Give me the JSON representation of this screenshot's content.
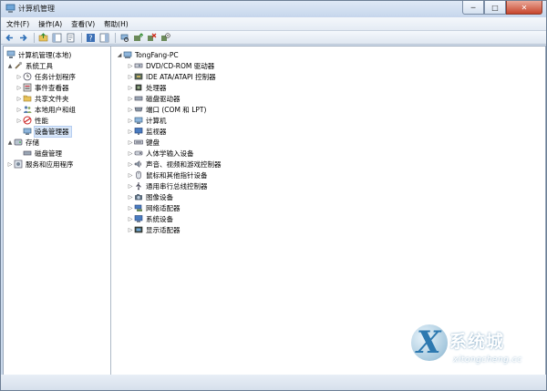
{
  "window": {
    "title": "计算机管理",
    "controls": [
      "─",
      "□",
      "✕"
    ]
  },
  "menu": [
    "文件(F)",
    "操作(A)",
    "查看(V)",
    "帮助(H)"
  ],
  "left_tree": [
    {
      "label": "计算机管理(本地)",
      "icon": "computer-mgmt-icon",
      "arrow": ""
    },
    {
      "label": "系统工具",
      "icon": "tools-icon",
      "arrow": "▲"
    },
    {
      "label": "任务计划程序",
      "icon": "clock-icon",
      "arrow": "▷"
    },
    {
      "label": "事件查看器",
      "icon": "event-viewer-icon",
      "arrow": "▷"
    },
    {
      "label": "共享文件夹",
      "icon": "shared-folder-icon",
      "arrow": "▷"
    },
    {
      "label": "本地用户和组",
      "icon": "users-icon",
      "arrow": "▷"
    },
    {
      "label": "性能",
      "icon": "performance-icon",
      "arrow": "▷"
    },
    {
      "label": "设备管理器",
      "icon": "device-manager-icon",
      "arrow": ""
    },
    {
      "label": "存储",
      "icon": "storage-icon",
      "arrow": "▲"
    },
    {
      "label": "磁盘管理",
      "icon": "disk-icon",
      "arrow": ""
    },
    {
      "label": "服务和应用程序",
      "icon": "services-icon",
      "arrow": "▷"
    }
  ],
  "right_tree": {
    "root": "TongFang-PC",
    "root_arrow": "◢",
    "devices": [
      {
        "label": "DVD/CD-ROM 驱动器",
        "icon": "dvd-drive-icon"
      },
      {
        "label": "IDE ATA/ATAPI 控制器",
        "icon": "ide-controller-icon"
      },
      {
        "label": "处理器",
        "icon": "processor-icon"
      },
      {
        "label": "磁盘驱动器",
        "icon": "disk-drive-icon"
      },
      {
        "label": "端口 (COM 和 LPT)",
        "icon": "port-icon"
      },
      {
        "label": "计算机",
        "icon": "computer-icon"
      },
      {
        "label": "监视器",
        "icon": "monitor-icon"
      },
      {
        "label": "键盘",
        "icon": "keyboard-icon"
      },
      {
        "label": "人体学输入设备",
        "icon": "hid-icon"
      },
      {
        "label": "声音、视频和游戏控制器",
        "icon": "sound-icon"
      },
      {
        "label": "鼠标和其他指针设备",
        "icon": "mouse-icon"
      },
      {
        "label": "通用串行总线控制器",
        "icon": "usb-icon"
      },
      {
        "label": "图像设备",
        "icon": "imaging-icon"
      },
      {
        "label": "网络适配器",
        "icon": "network-adapter-icon"
      },
      {
        "label": "系统设备",
        "icon": "system-devices-icon"
      },
      {
        "label": "显示适配器",
        "icon": "display-adapter-icon"
      }
    ]
  },
  "watermark": {
    "title": "系统城",
    "subtitle": "xitongcheng.cc"
  },
  "colors": {
    "chrome": "#cfdcec",
    "selection": "#d9e7f9",
    "accent": "#2d79b0"
  }
}
